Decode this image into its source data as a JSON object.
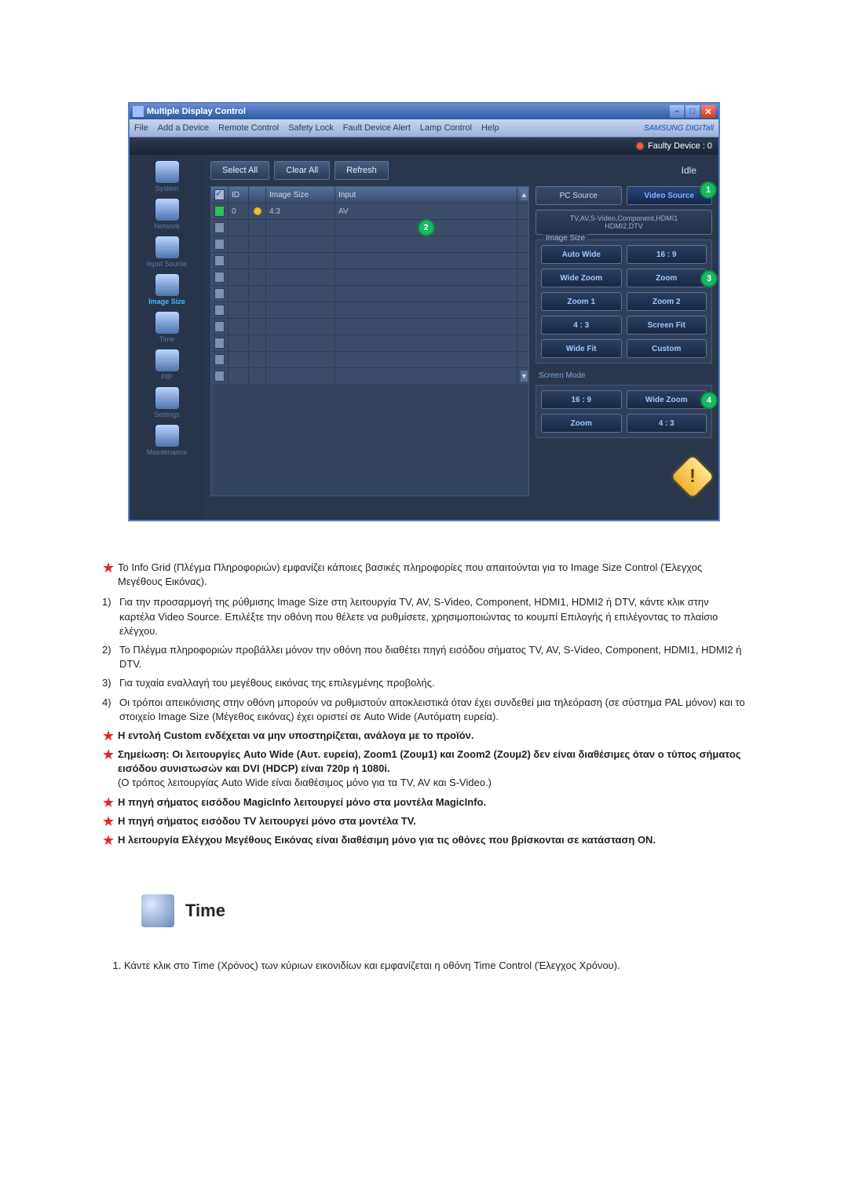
{
  "window": {
    "title": "Multiple Display Control",
    "menu": [
      "File",
      "Add a Device",
      "Remote Control",
      "Safety Lock",
      "Fault Device Alert",
      "Lamp Control",
      "Help"
    ],
    "brand": "SAMSUNG DIGITall",
    "faulty_label": "Faulty Device : 0",
    "idle": "Idle",
    "buttons": {
      "select_all": "Select All",
      "clear_all": "Clear All",
      "refresh": "Refresh"
    }
  },
  "sidebar": {
    "items": [
      {
        "label": "System"
      },
      {
        "label": "Network"
      },
      {
        "label": "Input Source"
      },
      {
        "label": "Image Size"
      },
      {
        "label": "Time"
      },
      {
        "label": "PIP"
      },
      {
        "label": "Settings"
      },
      {
        "label": "Maintenance"
      }
    ]
  },
  "grid": {
    "headers": {
      "id": "ID",
      "image_size": "Image Size",
      "input": "Input"
    },
    "row0": {
      "id": "0",
      "size": "4:3",
      "input": "AV"
    }
  },
  "ctrl": {
    "pc_source": "PC Source",
    "video_source": "Video Source",
    "note": "TV,AV,S-Video,Component,HDMI1\nHDMI2,DTV",
    "image_size_legend": "Image Size",
    "opts": [
      "Auto Wide",
      "16 : 9",
      "Wide Zoom",
      "Zoom",
      "Zoom 1",
      "Zoom 2",
      "4 : 3",
      "Screen Fit",
      "Wide Fit",
      "Custom"
    ],
    "screen_mode_legend": "Screen Mode",
    "screen_opts": [
      "16 : 9",
      "Wide Zoom",
      "Zoom",
      "4 : 3"
    ]
  },
  "badges": {
    "b1": "1",
    "b2": "2",
    "b3": "3",
    "b4": "4"
  },
  "notes": {
    "star0": "Το Info Grid (Πλέγμα Πληροφοριών) εμφανίζει κάποιες βασικές πληροφορίες που απαιτούνται για το Image Size Control (Έλεγχος Μεγέθους Εικόνας).",
    "n1": "Για την προσαρμογή της ρύθμισης Image Size στη λειτουργία TV, AV, S-Video, Component, HDMI1, HDMI2 ή DTV, κάντε κλικ στην καρτέλα Video Source. Επιλέξτε την οθόνη που θέλετε να ρυθμίσετε, χρησιμοποιώντας το κουμπί Επιλογής ή επιλέγοντας το πλαίσιο ελέγχου.",
    "n2": "Το Πλέγμα πληροφοριών προβάλλει μόνον την οθόνη που διαθέτει πηγή εισόδου σήματος TV, AV, S-Video, Component, HDMI1, HDMI2 ή DTV.",
    "n3": "Για τυχαία εναλλαγή του μεγέθους εικόνας της επιλεγμένης προβολής.",
    "n4": "Οι τρόποι απεικόνισης στην οθόνη μπορούν να ρυθμιστούν αποκλειστικά όταν έχει συνδεθεί μια τηλεόραση (σε σύστημα PAL μόνον) και το στοιχείο Image Size (Μέγεθος εικόνας) έχει οριστεί σε Auto Wide (Αυτόματη ευρεία).",
    "star1": "Η εντολή Custom ενδέχεται να μην υποστηρίζεται, ανάλογα με το προϊόν.",
    "star2a": "Σημείωση: Οι λειτουργίες Auto Wide (Αυτ. ευρεία), Zoom1 (Ζουμ1) και Zoom2 (Ζουμ2) δεν είναι διαθέσιμες όταν ο τύπος σήματος εισόδου συνιστωσών και DVI (HDCP) είναι 720p ή 1080i.",
    "star2b": "(Ο τρόπος λειτουργίας Auto Wide είναι διαθέσιμος μόνο για τα TV, AV και S-Video.)",
    "star3": "Η πηγή σήματος εισόδου MagicInfo λειτουργεί μόνο στα μοντέλα MagicInfo.",
    "star4": "Η πηγή σήματος εισόδου TV λειτουργεί μόνο στα μοντέλα TV.",
    "star5": "Η λειτουργία Ελέγχου Μεγέθους Εικόνας είναι διαθέσιμη μόνο για τις οθόνες που βρίσκονται σε κατάσταση ON."
  },
  "time": {
    "title": "Time",
    "item1": "Κάντε κλικ στο Time (Χρόνος) των κύριων εικονιδίων και εμφανίζεται η οθόνη Time Control (Έλεγχος Χρόνου)."
  }
}
